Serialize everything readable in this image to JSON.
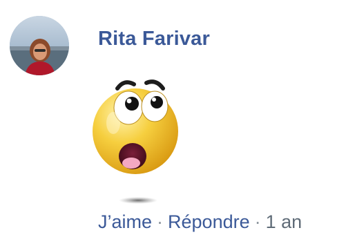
{
  "comment": {
    "author": "Rita Farivar",
    "sticker_icon": "shocked-face-sticker-icon",
    "actions": {
      "like_label": "J’aime",
      "reply_label": "Répondre",
      "separator": "·",
      "timestamp": "1 an"
    }
  },
  "colors": {
    "link": "#3b5998",
    "meta_text": "#5f6b77",
    "sticker_face": "#f5c935"
  }
}
